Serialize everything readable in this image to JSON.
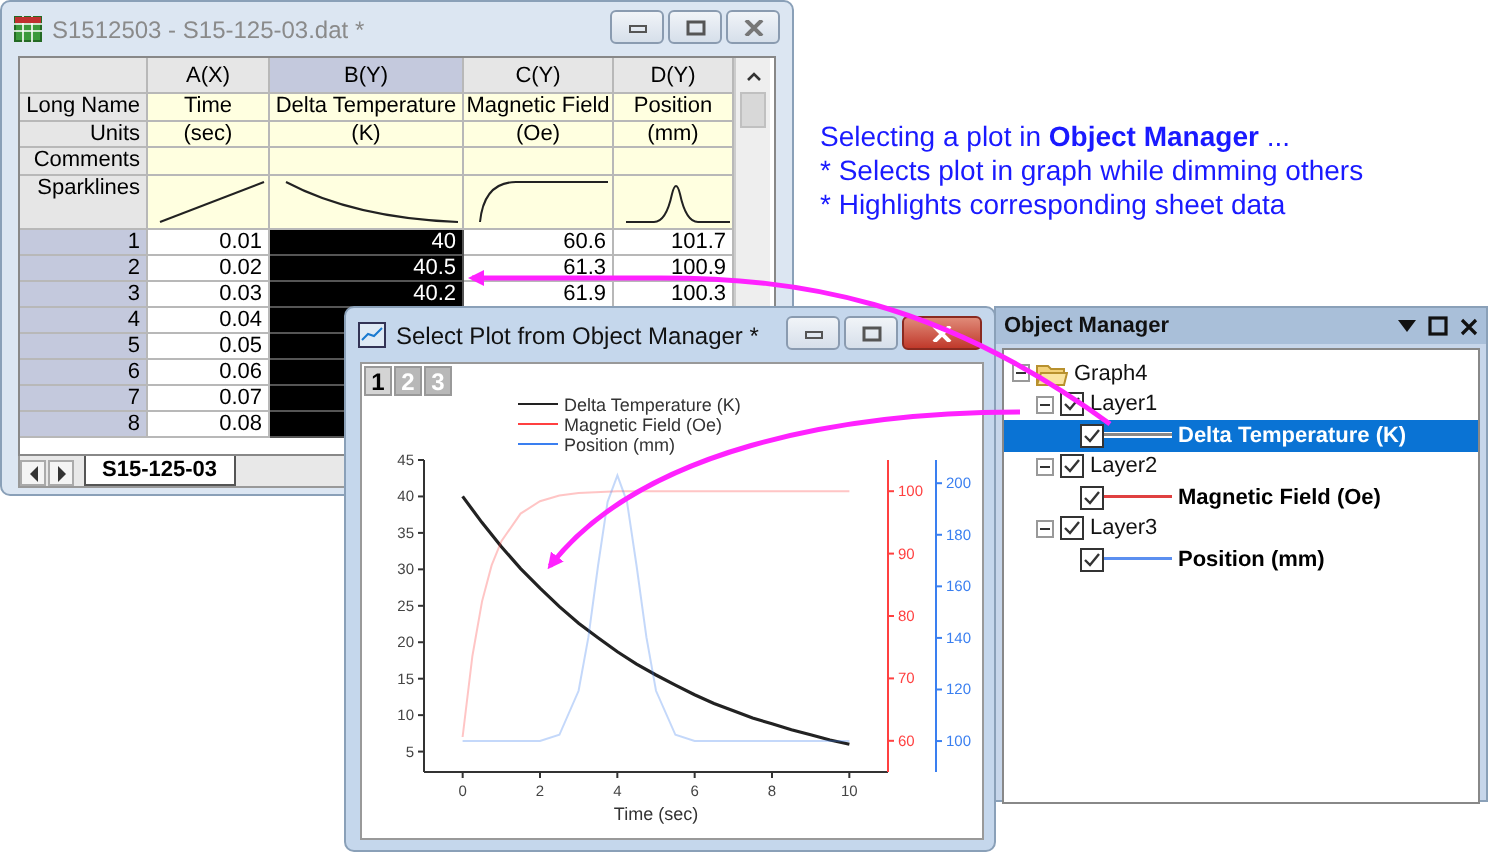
{
  "worksheet": {
    "title": "S1512503 - S15-125-03.dat *",
    "columns": [
      {
        "name": "A(X)",
        "long_name": "Time",
        "units": "(sec)",
        "selected": false
      },
      {
        "name": "B(Y)",
        "long_name": "Delta Temperature",
        "units": "(K)",
        "selected": true
      },
      {
        "name": "C(Y)",
        "long_name": "Magnetic Field",
        "units": "(Oe)",
        "selected": false
      },
      {
        "name": "D(Y)",
        "long_name": "Position",
        "units": "(mm)",
        "selected": false
      }
    ],
    "row_labels": [
      "Long Name",
      "Units",
      "Comments",
      "Sparklines"
    ],
    "rows": [
      {
        "label": "1",
        "cells": [
          "0.01",
          "40",
          "60.6",
          "101.7"
        ]
      },
      {
        "label": "2",
        "cells": [
          "0.02",
          "40.5",
          "61.3",
          "100.9"
        ]
      },
      {
        "label": "3",
        "cells": [
          "0.03",
          "40.2",
          "61.9",
          "100.3"
        ]
      },
      {
        "label": "4",
        "cells": [
          "0.04"
        ]
      },
      {
        "label": "5",
        "cells": [
          "0.05"
        ]
      },
      {
        "label": "6",
        "cells": [
          "0.06"
        ]
      },
      {
        "label": "7",
        "cells": [
          "0.07"
        ]
      },
      {
        "label": "8",
        "cells": [
          "0.08"
        ]
      }
    ],
    "sheet_tab": "S15-125-03"
  },
  "graph_window": {
    "title": "Select Plot from Object Manager *",
    "layers": [
      {
        "label": "1",
        "selected": true,
        "chart_data": {
          "type": "line",
          "xlabel": "Time (sec)",
          "x": [
            0,
            0.5,
            1,
            1.5,
            2,
            2.5,
            3,
            3.5,
            4,
            4.5,
            5,
            5.5,
            6,
            6.5,
            7,
            7.5,
            8,
            8.5,
            9,
            9.5,
            10
          ],
          "series": [
            {
              "name": "Delta Temperature (K)",
              "color": "#222222",
              "values": [
                40,
                36.4,
                33.1,
                30.1,
                27.4,
                24.9,
                22.6,
                20.6,
                18.7,
                17.0,
                15.5,
                14.1,
                12.8,
                11.6,
                10.6,
                9.6,
                8.8,
                8.0,
                7.3,
                6.6,
                6.0
              ]
            }
          ],
          "xlim": [
            -1,
            11
          ],
          "ylim": [
            2.2,
            45
          ],
          "xticks": [
            0,
            2,
            4,
            6,
            8,
            10
          ],
          "yticks": [
            5,
            10,
            15,
            20,
            25,
            30,
            35,
            40,
            45
          ],
          "legend": true
        }
      },
      {
        "label": "2",
        "selected": false,
        "chart_data": {
          "type": "line",
          "x": [
            0,
            0.25,
            0.5,
            0.75,
            1,
            1.5,
            2,
            2.5,
            3,
            4,
            5,
            6,
            7,
            8,
            9,
            10
          ],
          "series": [
            {
              "name": "Magnetic Field (Oe)",
              "color": "#ff4040",
              "values": [
                60.6,
                73.6,
                82.3,
                88.1,
                92.0,
                96.4,
                98.4,
                99.3,
                99.7,
                100,
                100,
                100,
                100,
                100,
                100,
                100
              ]
            }
          ],
          "xlim": [
            -1,
            11
          ],
          "ylim": [
            55,
            105
          ],
          "yticks": [
            60,
            70,
            80,
            90,
            100
          ]
        }
      },
      {
        "label": "3",
        "selected": false,
        "chart_data": {
          "type": "line",
          "x": [
            0,
            1,
            2,
            2.5,
            3,
            3.25,
            3.5,
            3.75,
            4,
            4.25,
            4.5,
            4.75,
            5,
            5.5,
            6,
            7,
            8,
            9,
            10
          ],
          "series": [
            {
              "name": "Position (mm)",
              "color": "#3a7ff0",
              "values": [
                100,
                100,
                100,
                102.4,
                119.5,
                140.3,
                167.9,
                192.8,
                203,
                192.8,
                167.9,
                140.3,
                119.5,
                102.4,
                100,
                100,
                100,
                100,
                100
              ]
            }
          ],
          "xlim": [
            -1,
            11
          ],
          "ylim": [
            88,
            209
          ],
          "yticks": [
            100,
            120,
            140,
            160,
            180,
            200
          ]
        }
      }
    ]
  },
  "caption": {
    "lines": [
      "Selecting a plot in **Object Manager** ...",
      "* Selects plot in graph while dimming others",
      "* Highlights corresponding sheet data"
    ]
  },
  "object_manager": {
    "title": "Object Manager",
    "graph": {
      "label": "Graph4",
      "expanded": true,
      "layers": [
        {
          "label": "Layer1",
          "expanded": true,
          "checked": true,
          "plots": [
            {
              "label": "Delta Temperature (K)",
              "checked": true,
              "selected": true,
              "color": "#888888"
            }
          ]
        },
        {
          "label": "Layer2",
          "expanded": true,
          "checked": true,
          "plots": [
            {
              "label": "Magnetic Field (Oe)",
              "checked": true,
              "selected": false,
              "color": "#e04040"
            }
          ]
        },
        {
          "label": "Layer3",
          "expanded": true,
          "checked": true,
          "plots": [
            {
              "label": "Position (mm)",
              "checked": true,
              "selected": false,
              "color": "#5b8ff0"
            }
          ]
        }
      ]
    }
  }
}
